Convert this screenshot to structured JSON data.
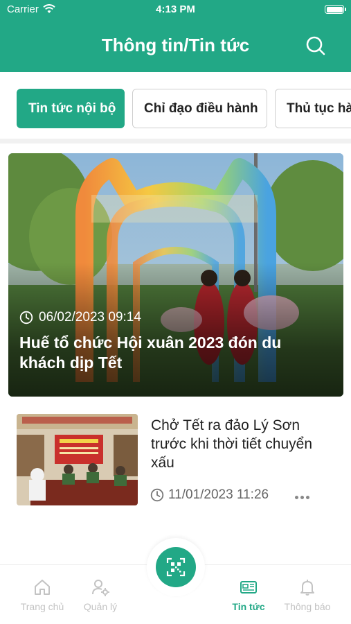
{
  "status_bar": {
    "carrier": "Carrier",
    "time": "4:13 PM"
  },
  "header": {
    "title": "Thông tin/Tin tức",
    "search_icon": "search-icon"
  },
  "tabs": [
    {
      "label": "Tin tức nội bộ",
      "active": true
    },
    {
      "label": "Chỉ đạo điều hành",
      "active": false
    },
    {
      "label": "Thủ tục hà",
      "active": false
    }
  ],
  "featured": {
    "datetime": "06/02/2023 09:14",
    "title": "Huế tổ chức Hội xuân 2023 đón du khách dịp Tết"
  },
  "news_items": [
    {
      "title": "Chở Tết ra đảo Lý Sơn trước khi thời tiết chuyển xấu",
      "datetime": "11/01/2023 11:26",
      "more_icon": "more-horizontal-icon"
    }
  ],
  "bottom_nav": {
    "items": [
      {
        "label": "Trang chủ",
        "icon": "home-icon",
        "active": false
      },
      {
        "label": "Quản lý",
        "icon": "manage-user-icon",
        "active": false
      },
      {
        "label": "Tin tức",
        "icon": "news-icon",
        "active": true
      },
      {
        "label": "Thông báo",
        "icon": "bell-icon",
        "active": false
      }
    ],
    "center_action_icon": "qr-scan-icon"
  },
  "colors": {
    "primary": "#22a886",
    "inactive": "#c3c3c3",
    "text": "#222222",
    "muted": "#666666"
  }
}
